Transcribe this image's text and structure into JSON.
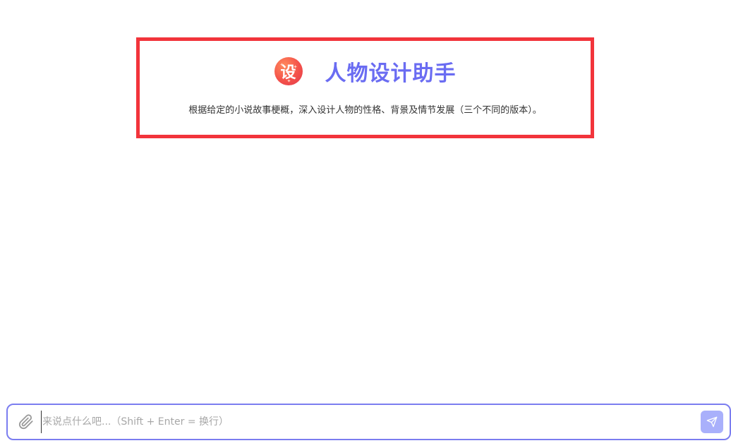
{
  "assistant": {
    "avatar_glyph": "设",
    "title": "人物设计助手",
    "description": "根据给定的小说故事梗概，深入设计人物的性格、背景及情节发展（三个不同的版本）。"
  },
  "composer": {
    "placeholder": "来说点什么吧...（Shift + Enter = 换行）",
    "attach_icon": "paperclip-icon",
    "send_icon": "send-icon"
  },
  "colors": {
    "highlight_border": "#f2343b",
    "title_color": "#6a6cf2",
    "composer_border": "#7b7df0",
    "send_button_bg": "#a9b0fb"
  }
}
